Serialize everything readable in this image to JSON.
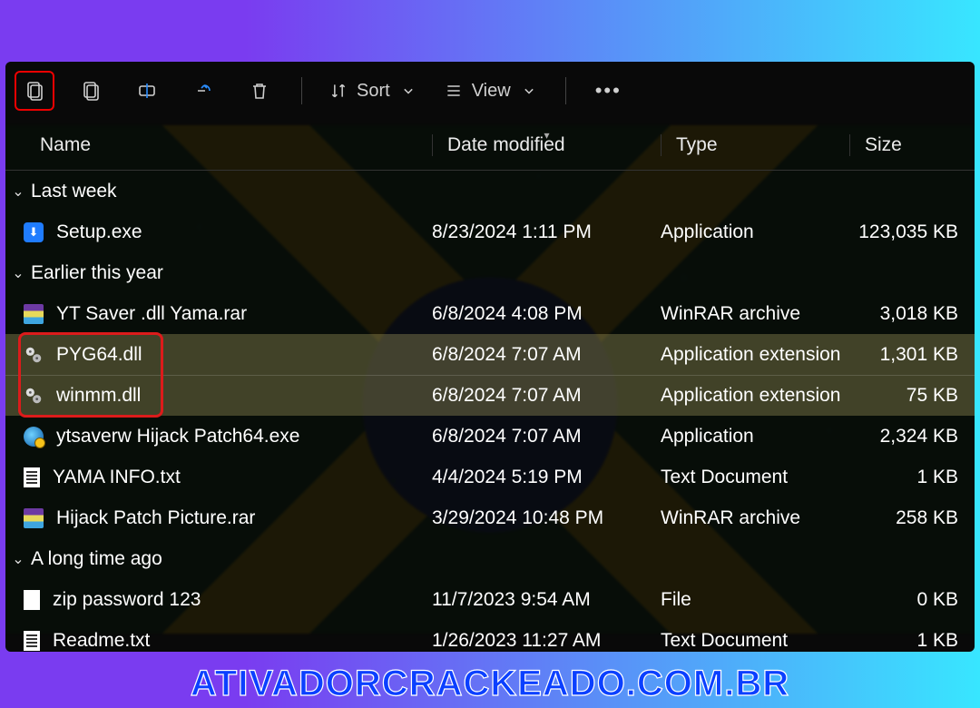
{
  "toolbar": {
    "sort_label": "Sort",
    "view_label": "View"
  },
  "columns": {
    "name": "Name",
    "date": "Date modified",
    "type": "Type",
    "size": "Size"
  },
  "groups": [
    {
      "label": "Last week",
      "rows": [
        {
          "icon": "setup",
          "name": "Setup.exe",
          "date": "8/23/2024 1:11 PM",
          "type": "Application",
          "size": "123,035 KB",
          "selected": false
        }
      ]
    },
    {
      "label": "Earlier this year",
      "rows": [
        {
          "icon": "rar",
          "name": "YT Saver .dll Yama.rar",
          "date": "6/8/2024 4:08 PM",
          "type": "WinRAR archive",
          "size": "3,018 KB",
          "selected": false
        },
        {
          "icon": "dll",
          "name": "PYG64.dll",
          "date": "6/8/2024 7:07 AM",
          "type": "Application extension",
          "size": "1,301 KB",
          "selected": true
        },
        {
          "icon": "dll",
          "name": "winmm.dll",
          "date": "6/8/2024 7:07 AM",
          "type": "Application extension",
          "size": "75 KB",
          "selected": true
        },
        {
          "icon": "globe",
          "name": "ytsaverw Hijack Patch64.exe",
          "date": "6/8/2024 7:07 AM",
          "type": "Application",
          "size": "2,324 KB",
          "selected": false
        },
        {
          "icon": "txt",
          "name": "YAMA INFO.txt",
          "date": "4/4/2024 5:19 PM",
          "type": "Text Document",
          "size": "1 KB",
          "selected": false
        },
        {
          "icon": "rar",
          "name": "Hijack Patch Picture.rar",
          "date": "3/29/2024 10:48 PM",
          "type": "WinRAR archive",
          "size": "258 KB",
          "selected": false
        }
      ]
    },
    {
      "label": "A long time ago",
      "rows": [
        {
          "icon": "file",
          "name": "zip password 123",
          "date": "11/7/2023 9:54 AM",
          "type": "File",
          "size": "0 KB",
          "selected": false
        },
        {
          "icon": "txt",
          "name": "Readme.txt",
          "date": "1/26/2023 11:27 AM",
          "type": "Text Document",
          "size": "1 KB",
          "selected": false
        }
      ]
    }
  ],
  "watermark": "ATIVADORCRACKEADO.COM.BR"
}
